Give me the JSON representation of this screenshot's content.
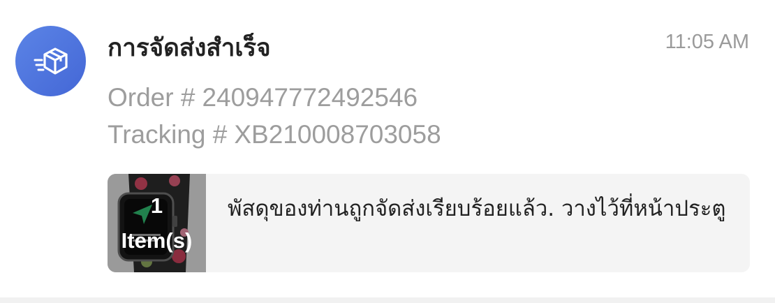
{
  "notification": {
    "icon": "delivery-box-icon",
    "title": "การจัดส่งสำเร็จ",
    "time": "11:05 AM",
    "order": {
      "label": "Order #",
      "value": "240947772492546"
    },
    "tracking": {
      "label": "Tracking #",
      "value": "XB210008703058"
    },
    "card": {
      "item_count": "1",
      "item_unit": "Item(s)",
      "message": "พัสดุของท่านถูกจัดส่งเรียบร้อยแล้ว. วางไว้ที่หน้าประตู"
    },
    "colors": {
      "avatar": "#4f75df",
      "title": "#222222",
      "muted": "#9d9d9d",
      "card_bg": "#f4f4f4"
    }
  }
}
